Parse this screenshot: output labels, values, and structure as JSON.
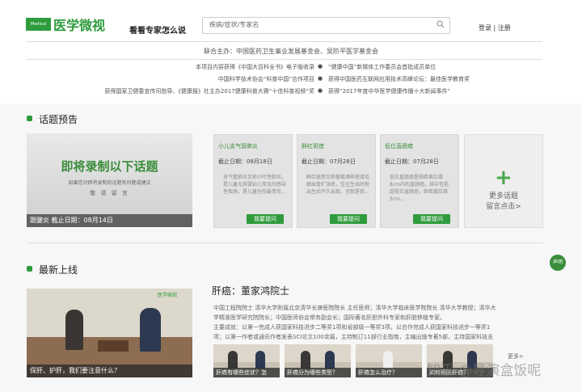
{
  "header": {
    "logo_small": "Medical Video",
    "logo_text": "医学微视",
    "tagline": "看看专家怎么说",
    "search_placeholder": "疾病/症状/专家名",
    "login": "登录 | 注册"
  },
  "sponsor": "联合主办：中国医药卫生事业发展基金会、吴阶平医学基金会",
  "notes": [
    [
      "本项目内容获得《中国大百科全书》电子版收录",
      "“健康中国”新媒体工作委员会首批成员单位"
    ],
    [
      "中国科学技术协会“科普中国”合作项目",
      "获得中国医药互联网应用技术高峰论坛：最佳医学教育奖"
    ],
    [
      "获得国家卫健委宣传司指导、《健康报》社主办2017健康科普大赛“十佳科普视频”奖",
      "获得“2017年度中华医学健康传播十大新闻事件”"
    ]
  ],
  "preview": {
    "section_title": "话题预告",
    "banner": {
      "title": "即将录制以下话题",
      "sub": "如果您对即将录制的话题有问题或建议",
      "sub2": "敬 请 留 言",
      "caption": "跟腱炎    截止日期：08月14日"
    },
    "cards": [
      {
        "title": "小儿支气管肺炎",
        "date": "截止日期：08月18日",
        "body": "支气管肺炎又称小叶性肺炎，是儿童尤其婴幼儿常见的感染性疾病，是儿童住院最常见...",
        "button": "我要提问"
      },
      {
        "title": "鲜红斑痣",
        "date": "截止日期：07月28日",
        "body": "鲜红斑痣又称葡萄酒样痣或毛细血管扩张痣，往往生出时就出生后不久出现，也就是我...",
        "button": "我要提问"
      },
      {
        "title": "低位直肠癌",
        "date": "截止日期：07月28日",
        "body": "低位直肠癌是指距离肛缘8cm内的直肠癌，其中包括超低位直肠癌，即距离肛缘5cm...",
        "button": "我要提问"
      }
    ],
    "more": {
      "line1": "更多话题",
      "line2": "留言点击>"
    }
  },
  "side_badge": "声明",
  "latest": {
    "section_title": "最新上线",
    "video_caption": "保肝、护肝，我们要注意什么？",
    "video_logo": "医学微视",
    "article_title": "肝癌：董家鸿院士",
    "lines": [
      "中国工程院院士  清华大学附属北京清华长庚医院院长  主任医师；清华大学临床医学院院长  清华大学教授；清华大",
      "学精准医学研究院院长；中国医师协会常务副会长；国际著名肝胆外科专家和肝脏移植专家。",
      "主要成就：以第一完成人获国家科技进步二等奖1项和省部级一等奖3项，以合作完成人获国家科技进步一等奖1",
      "项；以第一作者或通讯作者发表SCI论文100余篇，主持制订11部行业指南，主编出版专著5部，主持国家科技支"
    ],
    "thumbs": [
      "肝癌有哪些症状？怎",
      "肝癌分为哪些类型？",
      "肝癌怎么治疗？",
      "如何预防肝癌？"
    ],
    "more": "更多>"
  },
  "watermark": "知乎 @导演盒饭呢",
  "colors": {
    "brand": "#2e9b3c"
  }
}
